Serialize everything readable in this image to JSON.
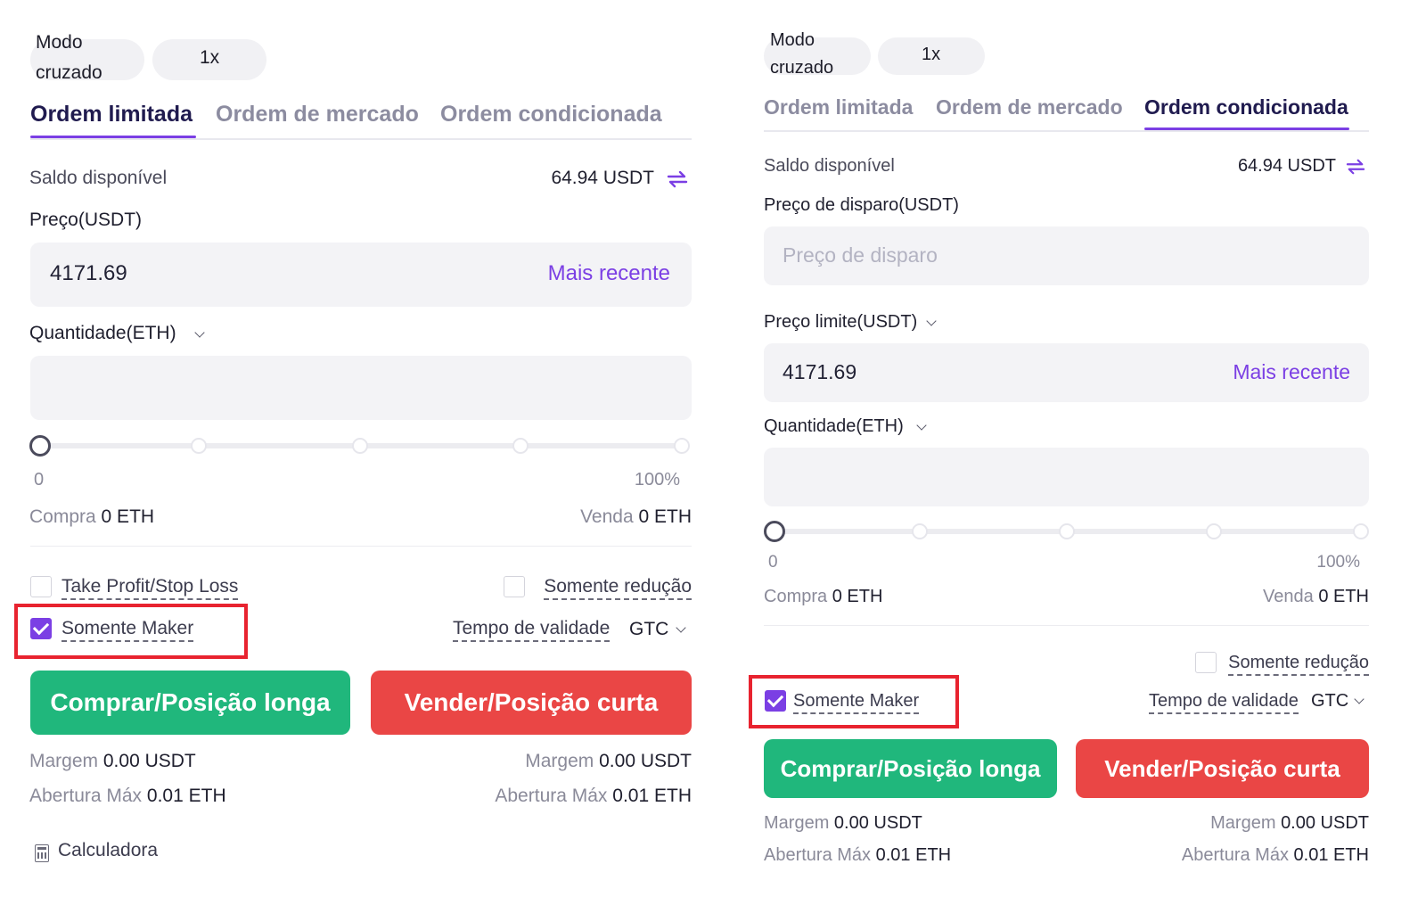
{
  "colors": {
    "accent": "#7b3fe4",
    "buy": "#20b77c",
    "sell": "#ea4645",
    "highlight": "#e8232f"
  },
  "left": {
    "mode": {
      "line1": "Modo",
      "line2": "cruzado"
    },
    "leverage": "1x",
    "tabs": [
      "Ordem limitada",
      "Ordem de mercado",
      "Ordem condicionada"
    ],
    "active_tab": "Ordem limitada",
    "balance": {
      "label": "Saldo disponível",
      "value": "64.94 USDT"
    },
    "price": {
      "label": "Preço(USDT)",
      "value": "4171.69",
      "latest": "Mais recente"
    },
    "quantity": {
      "label": "Quantidade(ETH)",
      "value": ""
    },
    "slider": {
      "min_label": "0",
      "max_label": "100%",
      "level": 0
    },
    "buy_amount": {
      "label": "Compra",
      "value": "0 ETH"
    },
    "sell_amount": {
      "label": "Venda",
      "value": "0 ETH"
    },
    "tpsl": {
      "label": "Take Profit/Stop Loss",
      "checked": false
    },
    "reduce_only": {
      "label": "Somente redução",
      "checked": false
    },
    "maker_only": {
      "label": "Somente Maker",
      "checked": true
    },
    "tif": {
      "label": "Tempo de validade",
      "value": "GTC"
    },
    "buy_button": "Comprar/Posição longa",
    "sell_button": "Vender/Posição curta",
    "margin_buy": {
      "label": "Margem",
      "value": "0.00 USDT"
    },
    "margin_sell": {
      "label": "Margem",
      "value": "0.00 USDT"
    },
    "max_open_buy": {
      "label": "Abertura Máx",
      "value": "0.01 ETH"
    },
    "max_open_sell": {
      "label": "Abertura Máx",
      "value": "0.01 ETH"
    },
    "calculator": "Calculadora"
  },
  "right": {
    "mode": {
      "line1": "Modo",
      "line2": "cruzado"
    },
    "leverage": "1x",
    "tabs": [
      "Ordem limitada",
      "Ordem de mercado",
      "Ordem condicionada"
    ],
    "active_tab": "Ordem condicionada",
    "balance": {
      "label": "Saldo disponível",
      "value": "64.94 USDT"
    },
    "trigger": {
      "label": "Preço de disparo(USDT)",
      "placeholder": "Preço de disparo"
    },
    "limit": {
      "label": "Preço limite(USDT)",
      "value": "4171.69",
      "latest": "Mais recente"
    },
    "quantity": {
      "label": "Quantidade(ETH)",
      "value": ""
    },
    "slider": {
      "min_label": "0",
      "max_label": "100%",
      "level": 0
    },
    "buy_amount": {
      "label": "Compra",
      "value": "0 ETH"
    },
    "sell_amount": {
      "label": "Venda",
      "value": "0 ETH"
    },
    "reduce_only": {
      "label": "Somente redução",
      "checked": false
    },
    "maker_only": {
      "label": "Somente Maker",
      "checked": true
    },
    "tif": {
      "label": "Tempo de validade",
      "value": "GTC"
    },
    "buy_button": "Comprar/Posição longa",
    "sell_button": "Vender/Posição curta",
    "margin_buy": {
      "label": "Margem",
      "value": "0.00 USDT"
    },
    "margin_sell": {
      "label": "Margem",
      "value": "0.00 USDT"
    },
    "max_open_buy": {
      "label": "Abertura Máx",
      "value": "0.01 ETH"
    },
    "max_open_sell": {
      "label": "Abertura Máx",
      "value": "0.01 ETH"
    }
  }
}
